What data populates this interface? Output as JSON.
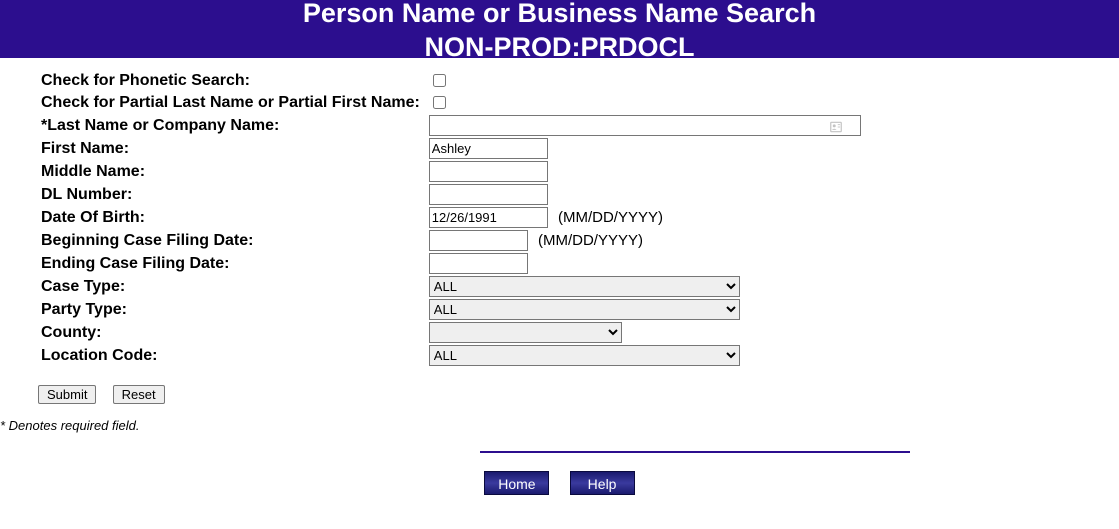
{
  "header": {
    "title": "Person Name or Business Name Search",
    "subtitle": "NON-PROD:PRDOCL"
  },
  "form": {
    "phonetic_label": "Check for Phonetic Search:",
    "partial_label": "Check for Partial Last Name or Partial First Name:",
    "lastname_label": "*Last Name or Company Name:",
    "lastname_value": "",
    "firstname_label": "First Name:",
    "firstname_value": "Ashley",
    "middlename_label": "Middle Name:",
    "middlename_value": "",
    "dlnumber_label": "DL Number:",
    "dlnumber_value": "",
    "dob_label": "Date Of Birth:",
    "dob_value": "12/26/1991",
    "dob_hint": "(MM/DD/YYYY)",
    "begin_date_label": "Beginning Case Filing Date:",
    "begin_date_value": "",
    "begin_date_hint": "(MM/DD/YYYY)",
    "end_date_label": "Ending Case Filing Date:",
    "end_date_value": "",
    "case_type_label": "Case Type:",
    "case_type_value": "ALL",
    "party_type_label": "Party Type:",
    "party_type_value": "ALL",
    "county_label": "County:",
    "county_value": "",
    "location_label": "Location Code:",
    "location_value": "ALL"
  },
  "buttons": {
    "submit": "Submit",
    "reset": "Reset"
  },
  "footnote": "* Denotes required field.",
  "footer": {
    "home": "Home",
    "help": "Help"
  }
}
